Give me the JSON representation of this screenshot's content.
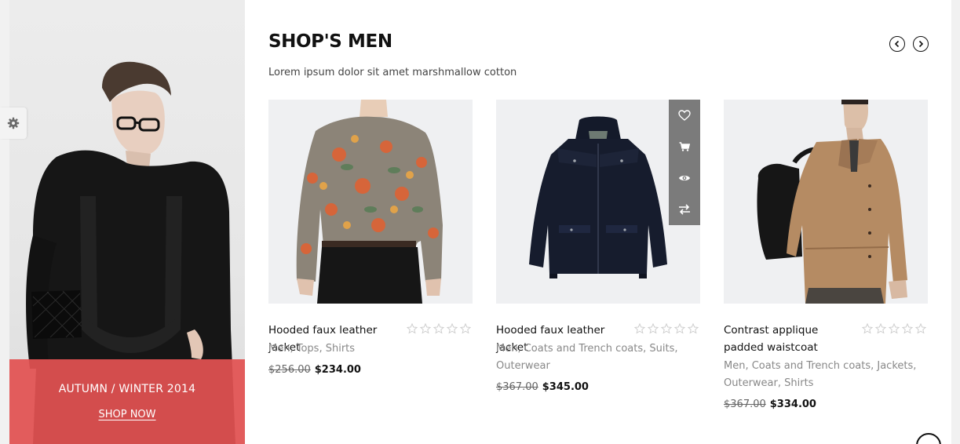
{
  "promo": {
    "title": "AUTUMN / WINTER 2014",
    "link_label": "SHOP NOW",
    "accent_color": "#e25252"
  },
  "section": {
    "title": "SHOP'S MEN",
    "subtitle": "Lorem ipsum dolor sit amet marshmallow cotton"
  },
  "icons": {
    "settings": "gear-icon",
    "prev": "chevron-left-icon",
    "next": "chevron-right-icon",
    "wishlist": "heart-icon",
    "cart": "cart-icon",
    "quickview": "eye-icon",
    "compare": "compare-arrows-icon",
    "rating": "star-icon"
  },
  "products": [
    {
      "name": "Hooded faux leather jacket",
      "categories": [
        "Men",
        "Tops",
        "Shirts"
      ],
      "old_price": "$256.00",
      "price": "$234.00",
      "rating": 0
    },
    {
      "name": "Hooded faux leather jacket",
      "categories": [
        "Men",
        "Coats and Trench coats",
        "Suits",
        "Outerwear"
      ],
      "old_price": "$367.00",
      "price": "$345.00",
      "rating": 0
    },
    {
      "name": "Contrast applique padded waistcoat",
      "categories": [
        "Men",
        "Coats and Trench coats",
        "Jackets",
        "Outerwear",
        "Shirts"
      ],
      "old_price": "$367.00",
      "price": "$334.00",
      "rating": 0
    }
  ]
}
